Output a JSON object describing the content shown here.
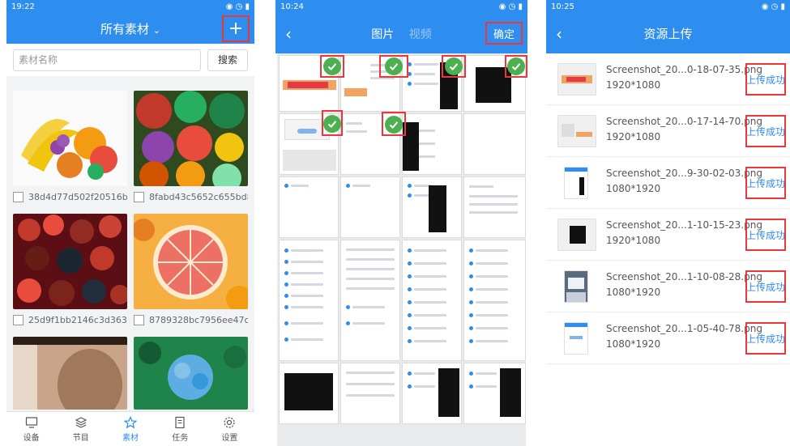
{
  "panel1": {
    "status_time": "19:22",
    "title": "所有素材",
    "search_placeholder": "素材名称",
    "search_button": "搜索",
    "items": [
      {
        "name": "38d4d77d502f20516b0..."
      },
      {
        "name": "8fabd43c5652c655bd8..."
      },
      {
        "name": "25d9f1bb2146c3d363a..."
      },
      {
        "name": "8789328bc7956ee47c..."
      }
    ],
    "tabs": [
      {
        "label": "设备",
        "icon": "monitor-icon"
      },
      {
        "label": "节目",
        "icon": "layers-icon"
      },
      {
        "label": "素材",
        "icon": "star-icon"
      },
      {
        "label": "任务",
        "icon": "document-icon"
      },
      {
        "label": "设置",
        "icon": "gear-icon"
      }
    ],
    "active_tab": "素材"
  },
  "panel2": {
    "status_time": "10:24",
    "tab_images": "图片",
    "tab_video": "视频",
    "confirm": "确定"
  },
  "panel3": {
    "status_time": "10:25",
    "title": "资源上传",
    "uploads": [
      {
        "name": "Screenshot_20...0-18-07-35.png",
        "dims": "1920*1080",
        "status": "上传成功"
      },
      {
        "name": "Screenshot_20...0-17-14-70.png",
        "dims": "1920*1080",
        "status": "上传成功"
      },
      {
        "name": "Screenshot_20...9-30-02-03.png",
        "dims": "1080*1920",
        "status": "上传成功"
      },
      {
        "name": "Screenshot_20...1-10-15-23.png",
        "dims": "1920*1080",
        "status": "上传成功"
      },
      {
        "name": "Screenshot_20...1-10-08-28.png",
        "dims": "1080*1920",
        "status": "上传成功"
      },
      {
        "name": "Screenshot_20...1-05-40-78.png",
        "dims": "1080*1920",
        "status": "上传成功"
      }
    ]
  },
  "colors": {
    "accent": "#2d8ef0",
    "highlight": "#e8383d",
    "check": "#4caf50"
  }
}
